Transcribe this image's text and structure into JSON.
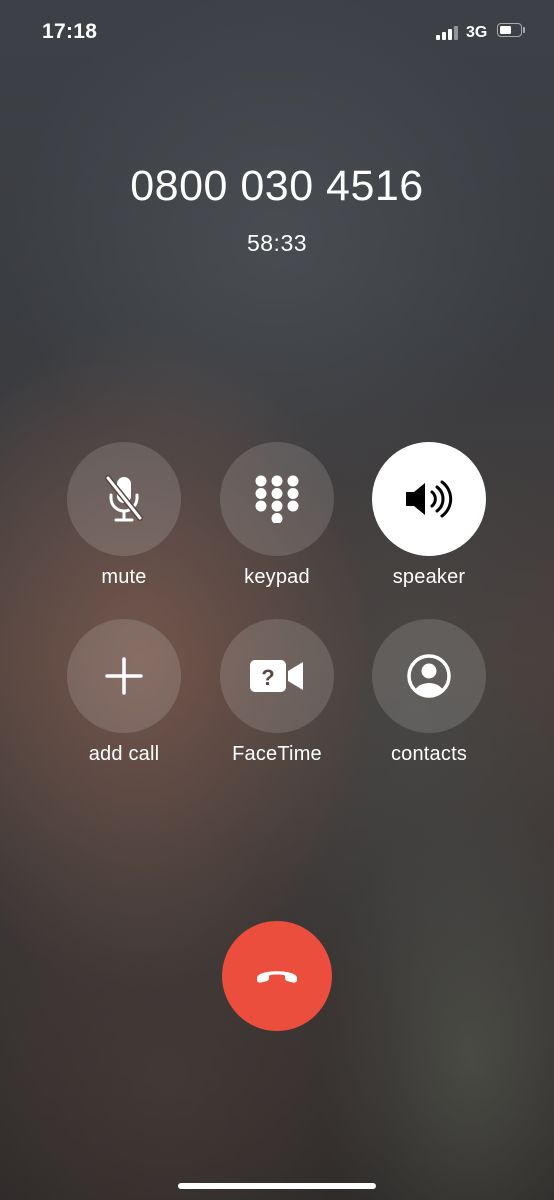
{
  "status_bar": {
    "time": "17:18",
    "network": "3G",
    "signal_bars": 3,
    "signal_bars_total": 4,
    "battery_level": 0.6
  },
  "call": {
    "number": "0800 030 4516",
    "duration": "58:33"
  },
  "controls": [
    {
      "label": "mute",
      "icon": "mic-slash-icon",
      "active": false
    },
    {
      "label": "keypad",
      "icon": "keypad-icon",
      "active": false
    },
    {
      "label": "speaker",
      "icon": "speaker-icon",
      "active": true
    },
    {
      "label": "add call",
      "icon": "plus-icon",
      "active": false
    },
    {
      "label": "FaceTime",
      "icon": "video-camera-icon",
      "active": false
    },
    {
      "label": "contacts",
      "icon": "person-circle-icon",
      "active": false
    }
  ],
  "end_call": {
    "icon": "phone-hangup-icon"
  },
  "colors": {
    "end_call_red": "#eb4e3d",
    "button_fill": "rgba(255,255,255,0.14)",
    "active_button_fill": "#ffffff",
    "active_icon": "#000000"
  }
}
